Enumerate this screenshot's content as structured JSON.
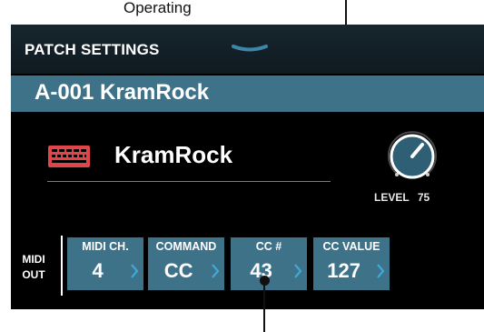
{
  "callout_text": "Operating",
  "screen": {
    "header_title": "PATCH SETTINGS",
    "patch_name": "A-001 KramRock",
    "instrument_name": "KramRock",
    "level_label": "LEVEL",
    "level_value": "75",
    "midi_label_line1": "MIDI",
    "midi_label_line2": "OUT",
    "params": [
      {
        "label": "MIDI CH.",
        "value": "4"
      },
      {
        "label": "COMMAND",
        "value": "CC"
      },
      {
        "label": "CC #",
        "value": "43"
      },
      {
        "label": "CC VALUE",
        "value": "127"
      }
    ]
  },
  "colors": {
    "accent_bar": "#3e7289",
    "keyboard_icon": "#e0454a",
    "background": "#000000"
  },
  "icons": [
    "chevron-down-icon",
    "keyboard-icon",
    "level-knob-icon",
    "chevron-right-icon"
  ]
}
